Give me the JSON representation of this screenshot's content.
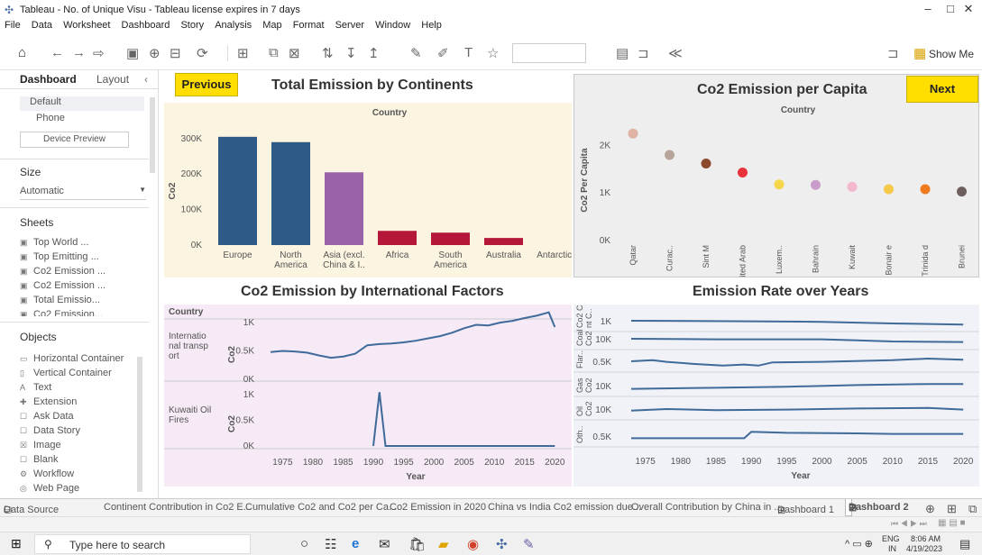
{
  "window": {
    "title": "Tableau - No. of Unique Visu - Tableau license expires in 7 days",
    "controls": [
      "–",
      "□",
      "✕"
    ]
  },
  "menu": [
    "File",
    "Data",
    "Worksheet",
    "Dashboard",
    "Story",
    "Analysis",
    "Map",
    "Format",
    "Server",
    "Window",
    "Help"
  ],
  "toolbar": {
    "show_me": "Show Me"
  },
  "left_panel": {
    "tabs": [
      "Dashboard",
      "Layout"
    ],
    "device": {
      "default": "Default",
      "phone": "Phone",
      "preview_button": "Device Preview"
    },
    "size": {
      "title": "Size",
      "value": "Automatic"
    },
    "sheets": {
      "title": "Sheets",
      "items": [
        "Top World ...",
        "Top Emitting ...",
        "Co2 Emission ...",
        "Co2 Emission ...",
        "Total Emissio...",
        "Co2 Emission..."
      ]
    },
    "objects": {
      "title": "Objects",
      "items": [
        "Horizontal Container",
        "Vertical Container",
        "Text",
        "Extension",
        "Ask Data",
        "Data Story",
        "Image",
        "Blank",
        "Workflow",
        "Web Page"
      ]
    }
  },
  "dashboard": {
    "previous_button": "Previous",
    "next_button": "Next"
  },
  "chart_data": [
    {
      "type": "bar",
      "title": "Total Emission by Continents",
      "subtitle": "Country",
      "ylabel": "Co2",
      "categories": [
        "Europe",
        "North America",
        "Asia (excl. China & I..",
        "Africa",
        "South America",
        "Australia",
        "Antarctica"
      ],
      "values": [
        305000,
        290000,
        205000,
        40000,
        35000,
        20000,
        0
      ],
      "colors": [
        "#2e5a87",
        "#2e5a87",
        "#9a62a8",
        "#b5173a",
        "#b5173a",
        "#b5173a",
        "#b5173a"
      ],
      "yticks": [
        "0K",
        "100K",
        "200K",
        "300K"
      ],
      "ylim": [
        0,
        330000
      ]
    },
    {
      "type": "scatter",
      "title": "Co2 Emission per Capita",
      "subtitle": "Country",
      "ylabel": "Co2 Per Capita",
      "categories": [
        "Qatar",
        "Curac..",
        "Sint M aarte..",
        "United Arab Emira..",
        "Luxem..",
        "Bahrain",
        "Kuwait",
        "Bonair e Sint E ustati..",
        "Trinida d and T obago",
        "Brunei"
      ],
      "values": [
        2250,
        1800,
        1620,
        1430,
        1180,
        1170,
        1130,
        1080,
        1080,
        1030
      ],
      "colors": [
        "#e0b4a4",
        "#b8a49a",
        "#8b4a2e",
        "#e8333d",
        "#f5d84a",
        "#c99cc9",
        "#f3b7cf",
        "#f7c94a",
        "#f07a1c",
        "#6e5e5e"
      ],
      "yticks": [
        "0K",
        "1K",
        "2K"
      ],
      "ylim": [
        0,
        2500
      ]
    },
    {
      "type": "line",
      "title": "Co2 Emission by International Factors",
      "subtitle": "Country",
      "xlabel": "Year",
      "ylabel": "Co2",
      "x_ticks": [
        "1975",
        "1980",
        "1985",
        "1990",
        "1995",
        "2000",
        "2005",
        "2010",
        "2015",
        "2020"
      ],
      "series": [
        {
          "name": "International transport",
          "x": [
            1973,
            1975,
            1977,
            1979,
            1981,
            1983,
            1985,
            1987,
            1989,
            1991,
            1993,
            1995,
            1997,
            1999,
            2001,
            2003,
            2005,
            2007,
            2009,
            2011,
            2013,
            2015,
            2017,
            2019,
            2020
          ],
          "values": [
            480,
            500,
            490,
            470,
            420,
            380,
            400,
            450,
            600,
            620,
            630,
            650,
            680,
            720,
            760,
            820,
            900,
            960,
            950,
            1000,
            1030,
            1080,
            1120,
            1180,
            920
          ],
          "yticks": [
            "0K",
            "0.5K",
            "1K"
          ]
        },
        {
          "name": "Kuwaiti Oil Fires",
          "x": [
            1990,
            1991,
            1992,
            2020
          ],
          "values": [
            0,
            1050,
            0,
            0
          ],
          "yticks": [
            "0K",
            "0.5K",
            "1K"
          ]
        }
      ]
    },
    {
      "type": "line",
      "title": "Emission Rate over Years",
      "xlabel": "Year",
      "x_ticks": [
        "1975",
        "1980",
        "1985",
        "1990",
        "1995",
        "2000",
        "2005",
        "2010",
        "2015",
        "2020"
      ],
      "series": [
        {
          "name": "Cement",
          "row_label": "Co2 Ceme nt C..",
          "yticks": [
            "1K"
          ]
        },
        {
          "name": "Coal",
          "row_label": "Coal Co2",
          "yticks": [
            "10K"
          ]
        },
        {
          "name": "Flaring",
          "row_label": "Flar..",
          "yticks": [
            "0.5K"
          ]
        },
        {
          "name": "Gas",
          "row_label": "Gas Co2",
          "yticks": [
            "10K"
          ]
        },
        {
          "name": "Oil",
          "row_label": "Oil Co2",
          "yticks": [
            "10K"
          ]
        },
        {
          "name": "Other",
          "row_label": "Oth..",
          "yticks": [
            "0.5K"
          ]
        }
      ]
    }
  ],
  "sheet_tabs": [
    "Data Source",
    "Continent Contribution in Co2 E...",
    "Cumulative Co2 and Co2 per Ca...",
    "Co2 Emission in 2020",
    "China vs India Co2 emission due...",
    "Overall Contribution by China in ...",
    "Dashboard 1",
    "Dashboard 2"
  ],
  "taskbar": {
    "search_placeholder": "Type here to search",
    "lang": "ENG",
    "region": "IN",
    "time": "8:06 AM",
    "date": "4/19/2023"
  }
}
